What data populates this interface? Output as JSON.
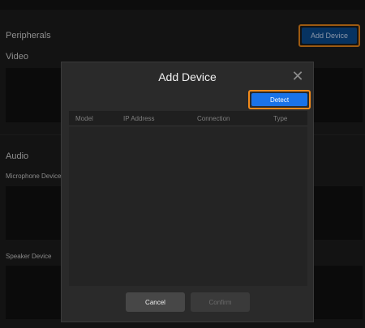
{
  "background": {
    "peripherals_title": "Peripherals",
    "video_title": "Video",
    "audio_title": "Audio",
    "microphone_label": "Microphone Device",
    "speaker_label": "Speaker Device",
    "add_device_button": "Add Device"
  },
  "dialog": {
    "title": "Add Device",
    "close_icon": "close-icon",
    "detect_button": "Detect",
    "table": {
      "columns": [
        "Model",
        "IP Address",
        "Connection",
        "Type"
      ],
      "rows": []
    },
    "cancel_button": "Cancel",
    "confirm_button": "Confirm"
  },
  "colors": {
    "accent_highlight": "#f28a1b",
    "primary_button": "#1a73e8",
    "add_button": "#0b4f96",
    "background": "#1e1e1e",
    "dialog_background": "#2a2a2a"
  }
}
